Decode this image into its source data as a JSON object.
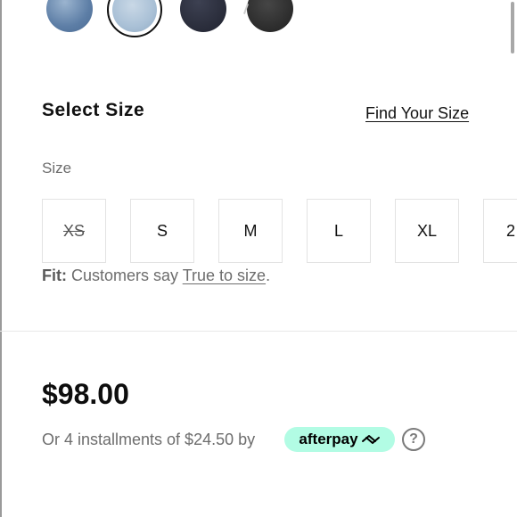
{
  "colors": {
    "swatches": [
      "light wash blue",
      "pale blue",
      "dark navy",
      "charcoal black"
    ],
    "accent_afterpay": "#b2fce4",
    "text_primary": "#111111",
    "text_muted": "#6d6d6d"
  },
  "size_section": {
    "title": "Select Size",
    "find_size_link": "Find Your Size",
    "label": "Size",
    "options": [
      {
        "label": "XS",
        "available": false
      },
      {
        "label": "S",
        "available": true
      },
      {
        "label": "M",
        "available": true
      },
      {
        "label": "L",
        "available": true
      },
      {
        "label": "XL",
        "available": true
      },
      {
        "label": "2",
        "available": true
      }
    ],
    "fit": {
      "key": "Fit:",
      "text": " Customers say ",
      "link": "True to size",
      "end": "."
    }
  },
  "pricing": {
    "price": "$98.00",
    "installments_text": "Or 4 installments of $24.50 by",
    "afterpay_label": "afterpay",
    "afterpay_icon": "afterpay-arrows-icon",
    "help_icon": "question-circle-icon",
    "help_symbol": "?"
  }
}
